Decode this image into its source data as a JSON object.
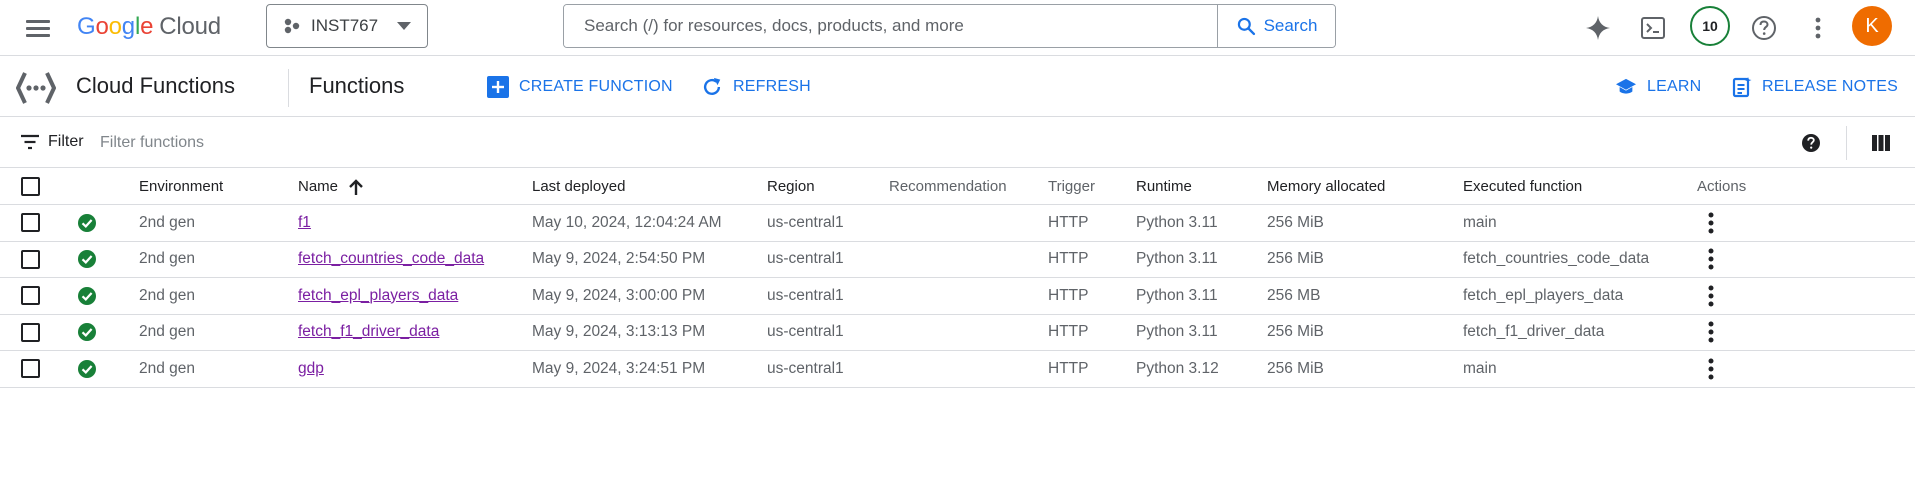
{
  "header": {
    "logo_letters": [
      "G",
      "o",
      "o",
      "g",
      "l",
      "e"
    ],
    "logo_suffix": "Cloud",
    "project_name": "INST767",
    "search_placeholder": "Search (/) for resources, docs, products, and more",
    "search_button": "Search",
    "notification_count": "10",
    "avatar_initial": "K"
  },
  "subheader": {
    "product_title": "Cloud Functions",
    "page_title": "Functions",
    "create_label": "CREATE FUNCTION",
    "refresh_label": "REFRESH",
    "learn_label": "LEARN",
    "release_notes_label": "RELEASE NOTES"
  },
  "filter": {
    "label": "Filter",
    "placeholder": "Filter functions"
  },
  "table": {
    "columns": {
      "environment": "Environment",
      "name": "Name",
      "last_deployed": "Last deployed",
      "region": "Region",
      "recommendation": "Recommendation",
      "trigger": "Trigger",
      "runtime": "Runtime",
      "memory": "Memory allocated",
      "executed": "Executed function",
      "actions": "Actions"
    },
    "rows": [
      {
        "environment": "2nd gen",
        "name": "f1",
        "last_deployed": "May 10, 2024, 12:04:24 AM",
        "region": "us-central1",
        "recommendation": "",
        "trigger": "HTTP",
        "runtime": "Python 3.11",
        "memory": "256 MiB",
        "executed": "main"
      },
      {
        "environment": "2nd gen",
        "name": "fetch_countries_code_data",
        "last_deployed": "May 9, 2024, 2:54:50 PM",
        "region": "us-central1",
        "recommendation": "",
        "trigger": "HTTP",
        "runtime": "Python 3.11",
        "memory": "256 MiB",
        "executed": "fetch_countries_code_data"
      },
      {
        "environment": "2nd gen",
        "name": "fetch_epl_players_data",
        "last_deployed": "May 9, 2024, 3:00:00 PM",
        "region": "us-central1",
        "recommendation": "",
        "trigger": "HTTP",
        "runtime": "Python 3.11",
        "memory": "256 MB",
        "executed": "fetch_epl_players_data"
      },
      {
        "environment": "2nd gen",
        "name": "fetch_f1_driver_data",
        "last_deployed": "May 9, 2024, 3:13:13 PM",
        "region": "us-central1",
        "recommendation": "",
        "trigger": "HTTP",
        "runtime": "Python 3.11",
        "memory": "256 MiB",
        "executed": "fetch_f1_driver_data"
      },
      {
        "environment": "2nd gen",
        "name": "gdp",
        "last_deployed": "May 9, 2024, 3:24:51 PM",
        "region": "us-central1",
        "recommendation": "",
        "trigger": "HTTP",
        "runtime": "Python 3.12",
        "memory": "256 MiB",
        "executed": "main"
      }
    ]
  },
  "colors": {
    "accent": "#1a73e8",
    "status_ok": "#188038",
    "visited_link": "#7b1fa2",
    "avatar": "#ef6c00"
  },
  "icons": {
    "menu": "hamburger-icon",
    "project": "project-hub-icon",
    "search": "search-icon",
    "gemini": "sparkle-icon",
    "shell": "terminal-icon",
    "help": "help-icon",
    "more": "more-vert-icon",
    "product": "cloud-functions-icon",
    "create": "add-box-icon",
    "refresh": "refresh-icon",
    "learn": "school-icon",
    "release_notes": "release-notes-icon",
    "filter": "filter-icon",
    "columns": "column-display-icon",
    "status": "check-circle-icon",
    "sort": "arrow-up-icon"
  }
}
